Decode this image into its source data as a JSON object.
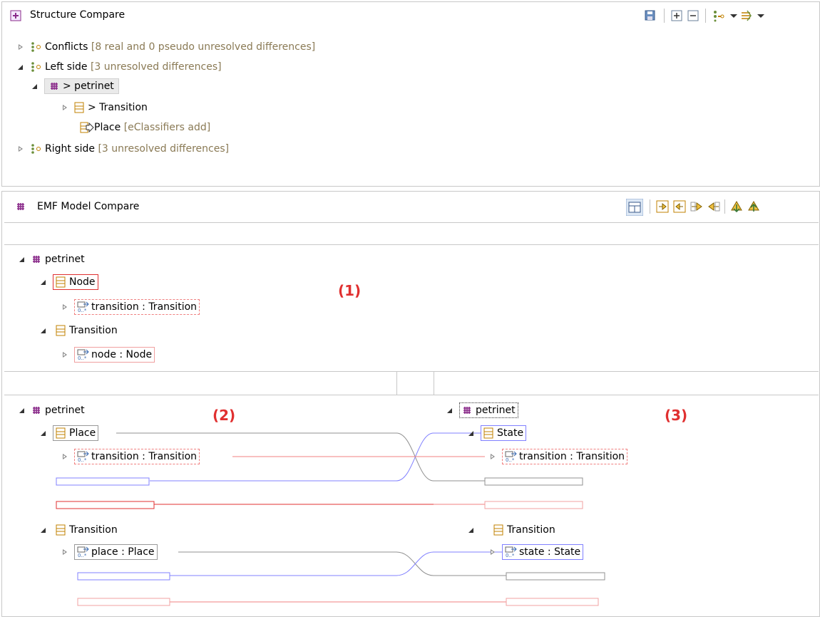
{
  "structure": {
    "title": "Structure Compare",
    "items": {
      "conflicts_label": "Conflicts",
      "conflicts_detail": "[8 real and 0 pseudo unresolved differences]",
      "left_label": "Left side",
      "left_detail": "[3 unresolved differences]",
      "petrinet": "> petrinet",
      "transition": "> Transition",
      "place": "Place",
      "place_detail": "[eClassifiers add]",
      "right_label": "Right side",
      "right_detail": "[3 unresolved differences]"
    }
  },
  "emf": {
    "title": "EMF Model Compare",
    "ancestor": {
      "petrinet": "petrinet",
      "node": "Node",
      "node_ref": "transition : Transition",
      "transition": "Transition",
      "transition_ref": "node : Node"
    },
    "left": {
      "petrinet": "petrinet",
      "place": "Place",
      "place_ref": "transition : Transition",
      "transition": "Transition",
      "transition_ref": "place : Place"
    },
    "right": {
      "petrinet": "petrinet",
      "state": "State",
      "state_ref": "transition : Transition",
      "transition": "Transition",
      "transition_ref": "state : State"
    },
    "markers": {
      "m1": "(1)",
      "m2": "(2)",
      "m3": "(3)"
    }
  },
  "colors": {
    "accent_red": "#e03030",
    "blue": "#8080ff",
    "pink": "#f08080",
    "grey": "#8a7a55",
    "package": "#8a2b8a"
  }
}
